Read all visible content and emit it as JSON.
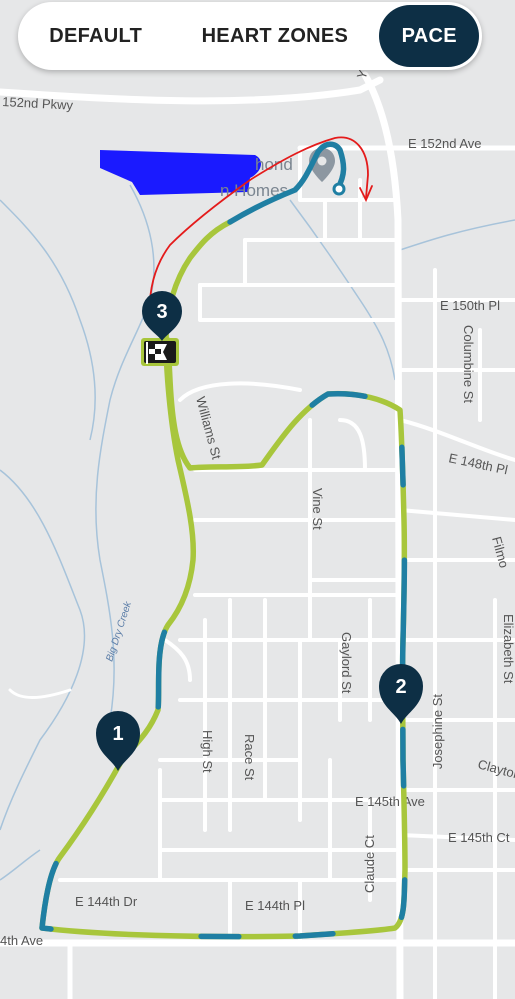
{
  "tabs": [
    {
      "label": "DEFAULT",
      "active": false
    },
    {
      "label": "HEART ZONES",
      "active": false
    },
    {
      "label": "PACE",
      "active": true
    }
  ],
  "streets": {
    "pkwy_152": "152nd Pkwy",
    "ave_152": "E 152nd Ave",
    "pl_150": "E 150th Pl",
    "columbine": "Columbine St",
    "pl_148": "E 148th Pl",
    "filmore": "Filmo",
    "williams": "Williams St",
    "vine": "Vine St",
    "gaylord": "Gaylord St",
    "elizabeth": "Elizabeth St",
    "josephine": "Josephine St",
    "clayton": "Clayton",
    "high": "High St",
    "race": "Race St",
    "ave_145": "E 145th Ave",
    "ct_145": "E 145th Ct",
    "claude": "Claude Ct",
    "dr_144": "E 144th Dr",
    "pl_144": "E 144th Pl",
    "ave_144": "4th Ave",
    "highway_y": "Y"
  },
  "creek_name": "Big Dry Creek",
  "poi_partial": [
    "hond",
    "n Homes"
  ],
  "markers": [
    {
      "label": "1"
    },
    {
      "label": "2"
    },
    {
      "label": "3"
    }
  ],
  "colors": {
    "pace_fast": "#1f7fa3",
    "pace_slow": "#a8c63c",
    "marker": "#0d2f45",
    "annotation": "#e41b1b",
    "redaction": "#1a1aff"
  },
  "icons": [
    "location-pin-icon",
    "finish-flag-icon"
  ]
}
